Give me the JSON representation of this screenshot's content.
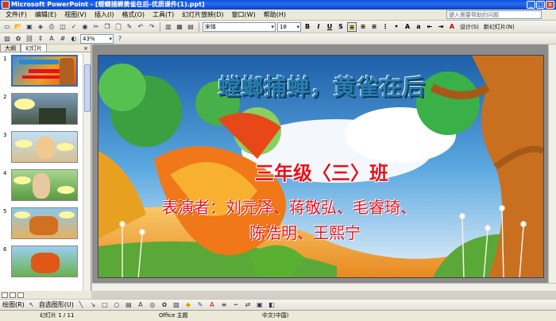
{
  "window": {
    "title": "Microsoft PowerPoint - [螳螂捕蝉黄雀在后-优质课件(1).ppt]"
  },
  "menu": {
    "items": [
      "文件(F)",
      "编辑(E)",
      "视图(V)",
      "插入(I)",
      "格式(O)",
      "工具(T)",
      "幻灯片放映(D)",
      "窗口(W)",
      "帮助(H)"
    ]
  },
  "help_search": {
    "placeholder": "键入需要帮助的问题"
  },
  "format_toolbar": {
    "font": "宋体",
    "size": "18",
    "design_label": "设计(S)",
    "new_slide_label": "新幻灯片(N)"
  },
  "standard_toolbar": {
    "zoom": "43%"
  },
  "panel": {
    "tab_outline": "大纲",
    "tab_slides": "幻灯片",
    "close": "×"
  },
  "thumbnails": [
    {
      "num": "1"
    },
    {
      "num": "2"
    },
    {
      "num": "3"
    },
    {
      "num": "4"
    },
    {
      "num": "5"
    },
    {
      "num": "6"
    }
  ],
  "slide": {
    "title": "螳螂捕蝉，黄雀在后",
    "class_line": "三年级〈三〉班",
    "cast_line1": "表演者：刘元泽、蒋敬弘、毛睿琦、",
    "cast_line2": "陈浩明、王熙宁"
  },
  "drawbar": {
    "draw_label": "绘图(R)",
    "autoshape_label": "自选图形(U)"
  },
  "status": {
    "slide_pos": "幻灯片 1 / 11",
    "theme": "Office 主题",
    "language": "中文(中国)"
  },
  "colors": {
    "title_bar": "#0a52dd",
    "accent_red": "#e8101c",
    "title_blue": "#2a7db0"
  }
}
